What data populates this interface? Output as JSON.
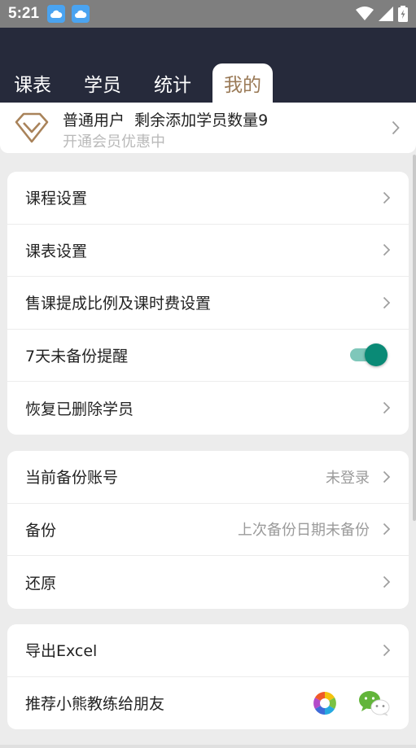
{
  "status_bar": {
    "time": "5:21",
    "icons": [
      "cloud-icon",
      "cloud-icon",
      "wifi-icon",
      "signal-icon",
      "battery-icon"
    ]
  },
  "tabs": [
    {
      "label": "课表",
      "active": false
    },
    {
      "label": "学员",
      "active": false
    },
    {
      "label": "统计",
      "active": false
    },
    {
      "label": "我的",
      "active": true
    }
  ],
  "member": {
    "title": "普通用户  剩余添加学员数量9",
    "subtitle": "开通会员优惠中"
  },
  "settings": {
    "course_settings": "课程设置",
    "schedule_settings": "课表设置",
    "commission_settings": "售课提成比例及课时费设置",
    "backup_reminder": "7天未备份提醒",
    "backup_reminder_on": true,
    "restore_deleted": "恢复已删除学员"
  },
  "backup": {
    "account_label": "当前备份账号",
    "account_value": "未登录",
    "backup_label": "备份",
    "backup_value": "上次备份日期未备份",
    "restore_label": "还原"
  },
  "misc": {
    "export_label": "导出Excel",
    "share_label": "推荐小熊教练给朋友"
  },
  "colors": {
    "header": "#262a3b",
    "accent_brown": "#9a7a57",
    "toggle_teal": "#0a8a76",
    "background": "#ececec"
  }
}
